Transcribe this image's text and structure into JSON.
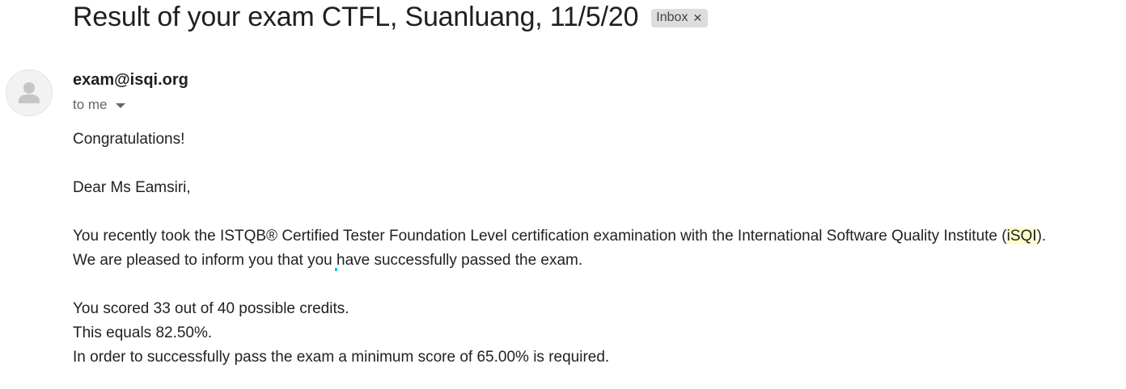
{
  "email": {
    "subject": "Result of your exam CTFL, Suanluang, 11/5/20",
    "label": "Inbox",
    "label_remove_icon": "close-icon",
    "sender": "exam@isqi.org",
    "recipients": "to me",
    "avatar_icon": "person-icon",
    "dropdown_icon": "chevron-down-icon",
    "body": {
      "greeting": "Congratulations!",
      "salutation": "Dear Ms Eamsiri,",
      "p1_line1_before": "You recently took the ISTQB® Certified Tester Foundation Level certification examination with the International Software Quality Institute (",
      "p1_line1_highlight": "iSQI",
      "p1_line1_after": ").",
      "p1_line2_before": "We are pleased to inform you that you ",
      "p1_line2_after": "have successfully passed the exam.",
      "score_line": "You scored 33 out of 40 possible credits.",
      "percent_line": "This equals 82.50%.",
      "requirement_line": "In order to successfully pass the exam a minimum score of 65.00% is required."
    }
  },
  "colors": {
    "highlight": "#fffbcc",
    "chip_bg": "#dddddd",
    "muted_text": "#5f6368"
  }
}
